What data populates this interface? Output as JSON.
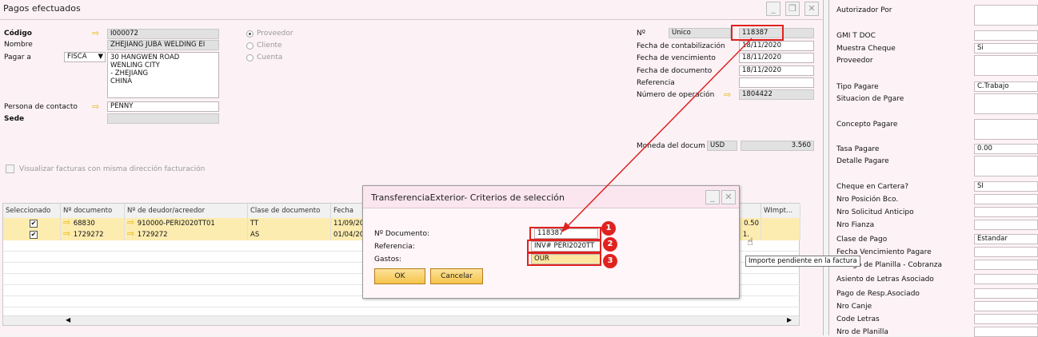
{
  "window": {
    "title": "Pagos efectuados"
  },
  "header": {
    "codigo_label": "Código",
    "codigo": "I000072",
    "nombre_label": "Nombre",
    "nombre": "ZHEJIANG JUBA WELDING EI",
    "pagar_label": "Pagar a",
    "pagar_sel": "FISCA",
    "address": [
      "30 HANGWEN ROAD",
      "WENLING CITY",
      "- ZHEJIANG",
      "CHINA"
    ],
    "contacto_label": "Persona de contacto",
    "contacto": "PENNY",
    "sede_label": "Sede",
    "radios": [
      "Proveedor",
      "Cliente",
      "Cuenta"
    ],
    "checkbox_label": "Visualizar facturas con misma dirección facturación"
  },
  "right": {
    "no_label": "Nº",
    "serie": "Único",
    "numero": "118387",
    "fcont_label": "Fecha de contabilización",
    "fcont": "18/11/2020",
    "fvenc_label": "Fecha de vencimiento",
    "fvenc": "18/11/2020",
    "fdoc_label": "Fecha de documento",
    "fdoc": "18/11/2020",
    "ref_label": "Referencia",
    "nop_label": "Número de operación",
    "nop": "1804422",
    "moneda_label": "Moneda del docum",
    "moneda": "USD",
    "rate": "3.560"
  },
  "grid": {
    "headers": [
      "Seleccionado",
      "Nº documento",
      "Nº de deudor/acreedor",
      "Clase de documento",
      "Fecha",
      "WImpt..."
    ],
    "rows": [
      {
        "doc": "68830",
        "deudor": "910000-PERI2020TT01",
        "clase": "TT",
        "fecha": "11/09/20",
        "tail": "0.50"
      },
      {
        "doc": "1729272",
        "deudor": "1729272",
        "clase": "AS",
        "fecha": "01/04/20",
        "tail": "1."
      }
    ]
  },
  "dialog": {
    "title": "TransferenciaExterior- Criterios de selección",
    "doc_label": "Nº Documento:",
    "doc": "118387",
    "ref_label": "Referencia:",
    "ref": "INV# PERI2020TT",
    "gastos_label": "Gastos:",
    "gastos": "OUR",
    "ok": "OK",
    "cancel": "Cancelar",
    "badges": [
      "1",
      "2",
      "3"
    ]
  },
  "tooltip": "Importe pendiente en la factura",
  "side": [
    {
      "label": "Autorizador Por",
      "value": ""
    },
    {
      "label": "GMI T DOC",
      "value": ""
    },
    {
      "label": "Muestra Cheque",
      "value": "Si"
    },
    {
      "label": "Proveedor",
      "value": ""
    },
    {
      "label": "Tipo Pagare",
      "value": "C.Trabajo"
    },
    {
      "label": "Situacion de Pgare",
      "value": ""
    },
    {
      "label": "Concepto Pagare",
      "value": ""
    },
    {
      "label": "Tasa Pagare",
      "value": "0.00"
    },
    {
      "label": "Detalle Pagare",
      "value": ""
    },
    {
      "label": "Cheque en Cartera?",
      "value": "SI"
    },
    {
      "label": "Nro Posición Bco.",
      "value": ""
    },
    {
      "label": "Nro Solicitud Anticipo",
      "value": ""
    },
    {
      "label": "Nro Fianza",
      "value": ""
    },
    {
      "label": "Clase de Pago",
      "value": "Estandar"
    },
    {
      "label": "Fecha Vencimiento Pagare",
      "value": ""
    },
    {
      "label": "Codigo de Planilla - Cobranza",
      "value": ""
    },
    {
      "label": "Asiento de Letras Asociado",
      "value": ""
    },
    {
      "label": "Pago de Resp.Asociado",
      "value": ""
    },
    {
      "label": "Nro Canje",
      "value": ""
    },
    {
      "label": "Code Letras",
      "value": ""
    },
    {
      "label": "Nro de Planilla",
      "value": ""
    }
  ],
  "colors": {
    "highlight": "#e0221f",
    "selected_row": "#fdecb0"
  }
}
